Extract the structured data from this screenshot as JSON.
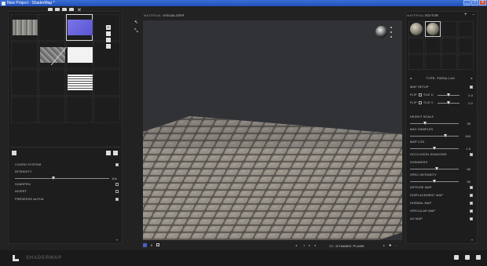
{
  "window": {
    "title": "New Project - ShaderMap *",
    "min": "_",
    "max": "□",
    "close": "x"
  },
  "toolbar": {
    "tools_glyph": "✕"
  },
  "map_grid": {
    "side_buttons": [
      "N",
      "",
      "",
      ""
    ]
  },
  "left_props": {
    "coord_system": "COORD SYSTEM",
    "intensity": {
      "label": "INTENSITY",
      "value": "104",
      "level": 0.41
    },
    "sharpen": "SHARPEN",
    "invert": "INVERT",
    "preserve_alpha": "PRESERVE ALPHA",
    "preserve_alpha_checked": true
  },
  "viewport": {
    "label_prefix": "MATERIAL",
    "label_main": "VISUALIZER",
    "tools": [
      "↖",
      "⤡"
    ],
    "gizmo_dots": 3,
    "bottom": {
      "nav": [
        "◂",
        "1",
        "▸",
        "◂"
      ],
      "prefix": "3D:",
      "mode": "DYNAMIC PLANE",
      "right": [
        "▸",
        "✚",
        "‒"
      ]
    }
  },
  "material_editor": {
    "label_prefix": "MATERIAL",
    "label_main": "EDITOR",
    "plus": "+",
    "minus": "‒",
    "type_label": "TYPE: PARALLAX",
    "map_setup": "MAP SETUP",
    "flip_u": "FLIP",
    "tile_u": "TILE U",
    "tile_u_value": "1.0",
    "flip_v": "FLIP",
    "tile_v": "TILE V",
    "tile_v_value": "1.0",
    "height_scale": {
      "label": "HEIGHT SCALE",
      "value": "30",
      "level": 0.3
    },
    "max_samples": {
      "label": "MAX SAMPLES",
      "value": "140",
      "level": 0.72
    },
    "map_lod": {
      "label": "MAP LOD",
      "value": "1.0",
      "level": 0.5
    },
    "occlusion_shadows": "OCCLUSION SHADOWS",
    "shininess": {
      "label": "SHININESS",
      "value": "60",
      "level": 0.55
    },
    "spec_intensity": {
      "label": "SPEC INTENSITY",
      "value": "50",
      "level": 0.5
    },
    "toggles": [
      "DIFFUSE MAP",
      "DISPLACEMENT MAP",
      "NORMAL MAP",
      "SPECULAR MAP",
      "AO MAP"
    ]
  },
  "status": {
    "brand": "SHADERMAP"
  }
}
